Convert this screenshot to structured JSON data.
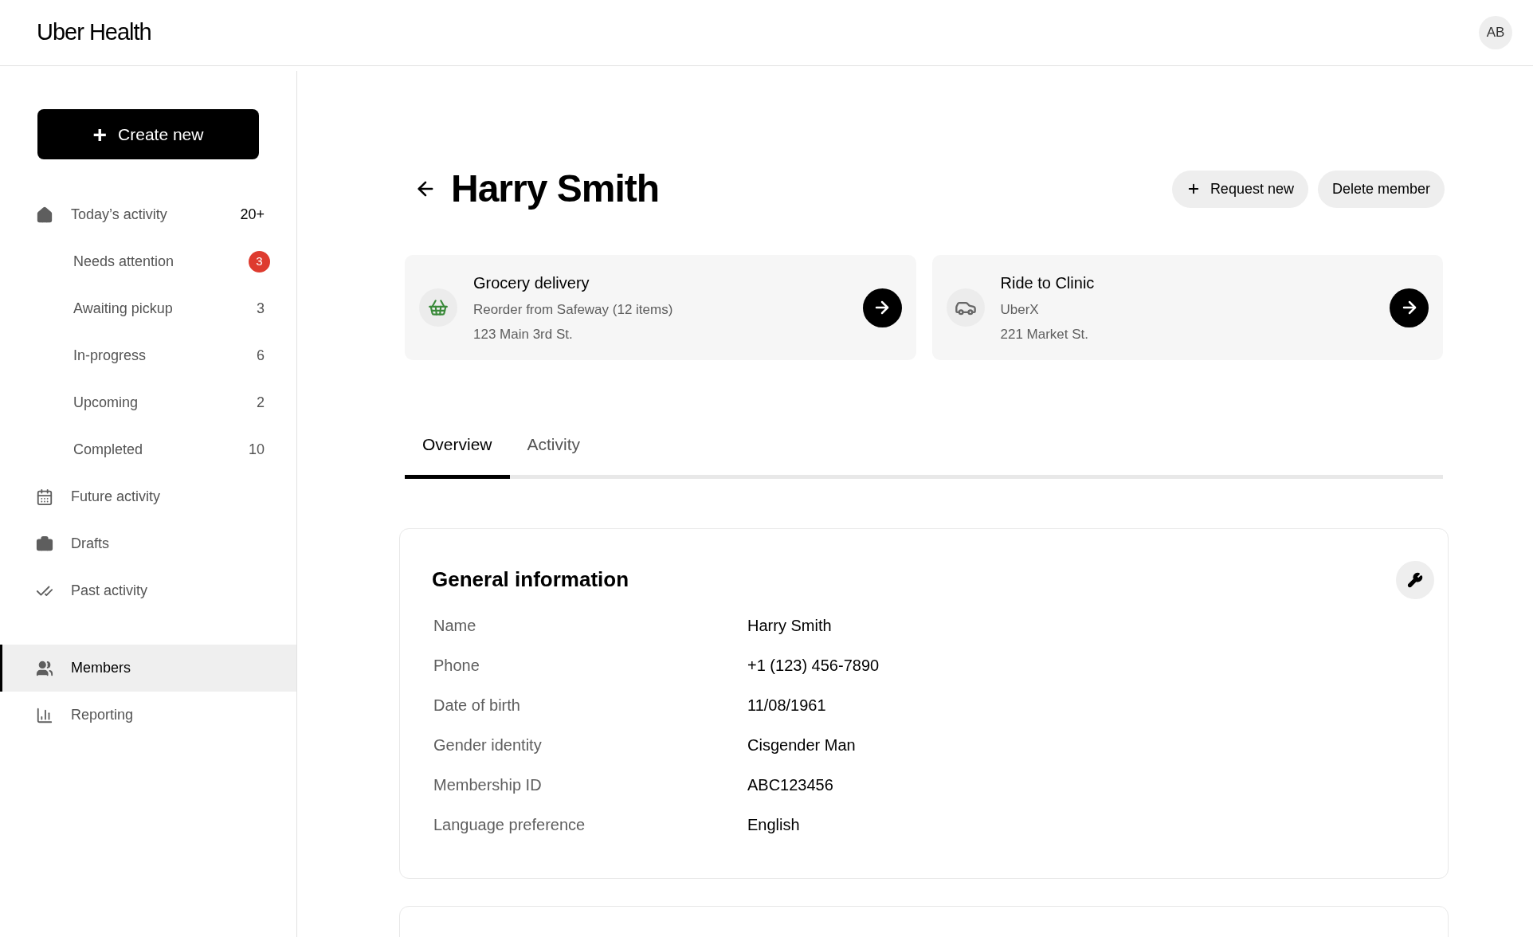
{
  "header": {
    "logo": "Uber Health",
    "avatar": "AB"
  },
  "sidebar": {
    "create_button": "+",
    "create_label": "Create new",
    "items": [
      {
        "kind": "main",
        "label": "Today’s activity",
        "count": "20+",
        "alert": false,
        "selected": false
      },
      {
        "kind": "sub",
        "label": "Needs attention",
        "count": "3",
        "alert": true,
        "selected": false
      },
      {
        "kind": "sub",
        "label": "Awaiting pickup",
        "count": "3",
        "alert": false,
        "selected": false
      },
      {
        "kind": "sub",
        "label": "In-progress",
        "count": "6",
        "alert": false,
        "selected": false
      },
      {
        "kind": "sub",
        "label": "Upcoming",
        "count": "2",
        "alert": false,
        "selected": false
      },
      {
        "kind": "sub",
        "label": "Completed",
        "count": "10",
        "alert": false,
        "selected": false
      },
      {
        "kind": "main",
        "label": "Future activity",
        "selected": false
      },
      {
        "kind": "main",
        "label": "Drafts",
        "selected": false
      },
      {
        "kind": "main",
        "label": "Past activity",
        "selected": false
      },
      {
        "kind": "gap"
      },
      {
        "kind": "main",
        "label": "Members",
        "selected": true
      },
      {
        "kind": "main",
        "label": "Reporting",
        "selected": false
      }
    ]
  },
  "page": {
    "title": "Harry Smith",
    "buttons": [
      {
        "kind": "add",
        "label": "Request new"
      },
      {
        "kind": "plain",
        "label": "Delete member"
      }
    ]
  },
  "cards": [
    {
      "kind": "grocery",
      "title": "Grocery delivery",
      "line1": "Reorder from Safeway (12 items)",
      "line2": "123 Main 3rd St."
    },
    {
      "kind": "ride",
      "title": "Ride to Clinic",
      "line1": "UberX",
      "line2": "221 Market St."
    }
  ],
  "tabs": [
    {
      "label": "Overview",
      "selected": true
    },
    {
      "label": "Activity",
      "selected": false
    }
  ],
  "general_information": {
    "title": "General information",
    "rows": [
      {
        "label": "Name",
        "value": "Harry Smith"
      },
      {
        "label": "Phone",
        "value": "+1 (123) 456-7890"
      },
      {
        "label": "Date of birth",
        "value": "11/08/1961"
      },
      {
        "label": "Gender identity",
        "value": "Cisgender Man"
      },
      {
        "label": "Membership ID",
        "value": "ABC123456"
      },
      {
        "label": "Language preference",
        "value": "English"
      }
    ]
  }
}
